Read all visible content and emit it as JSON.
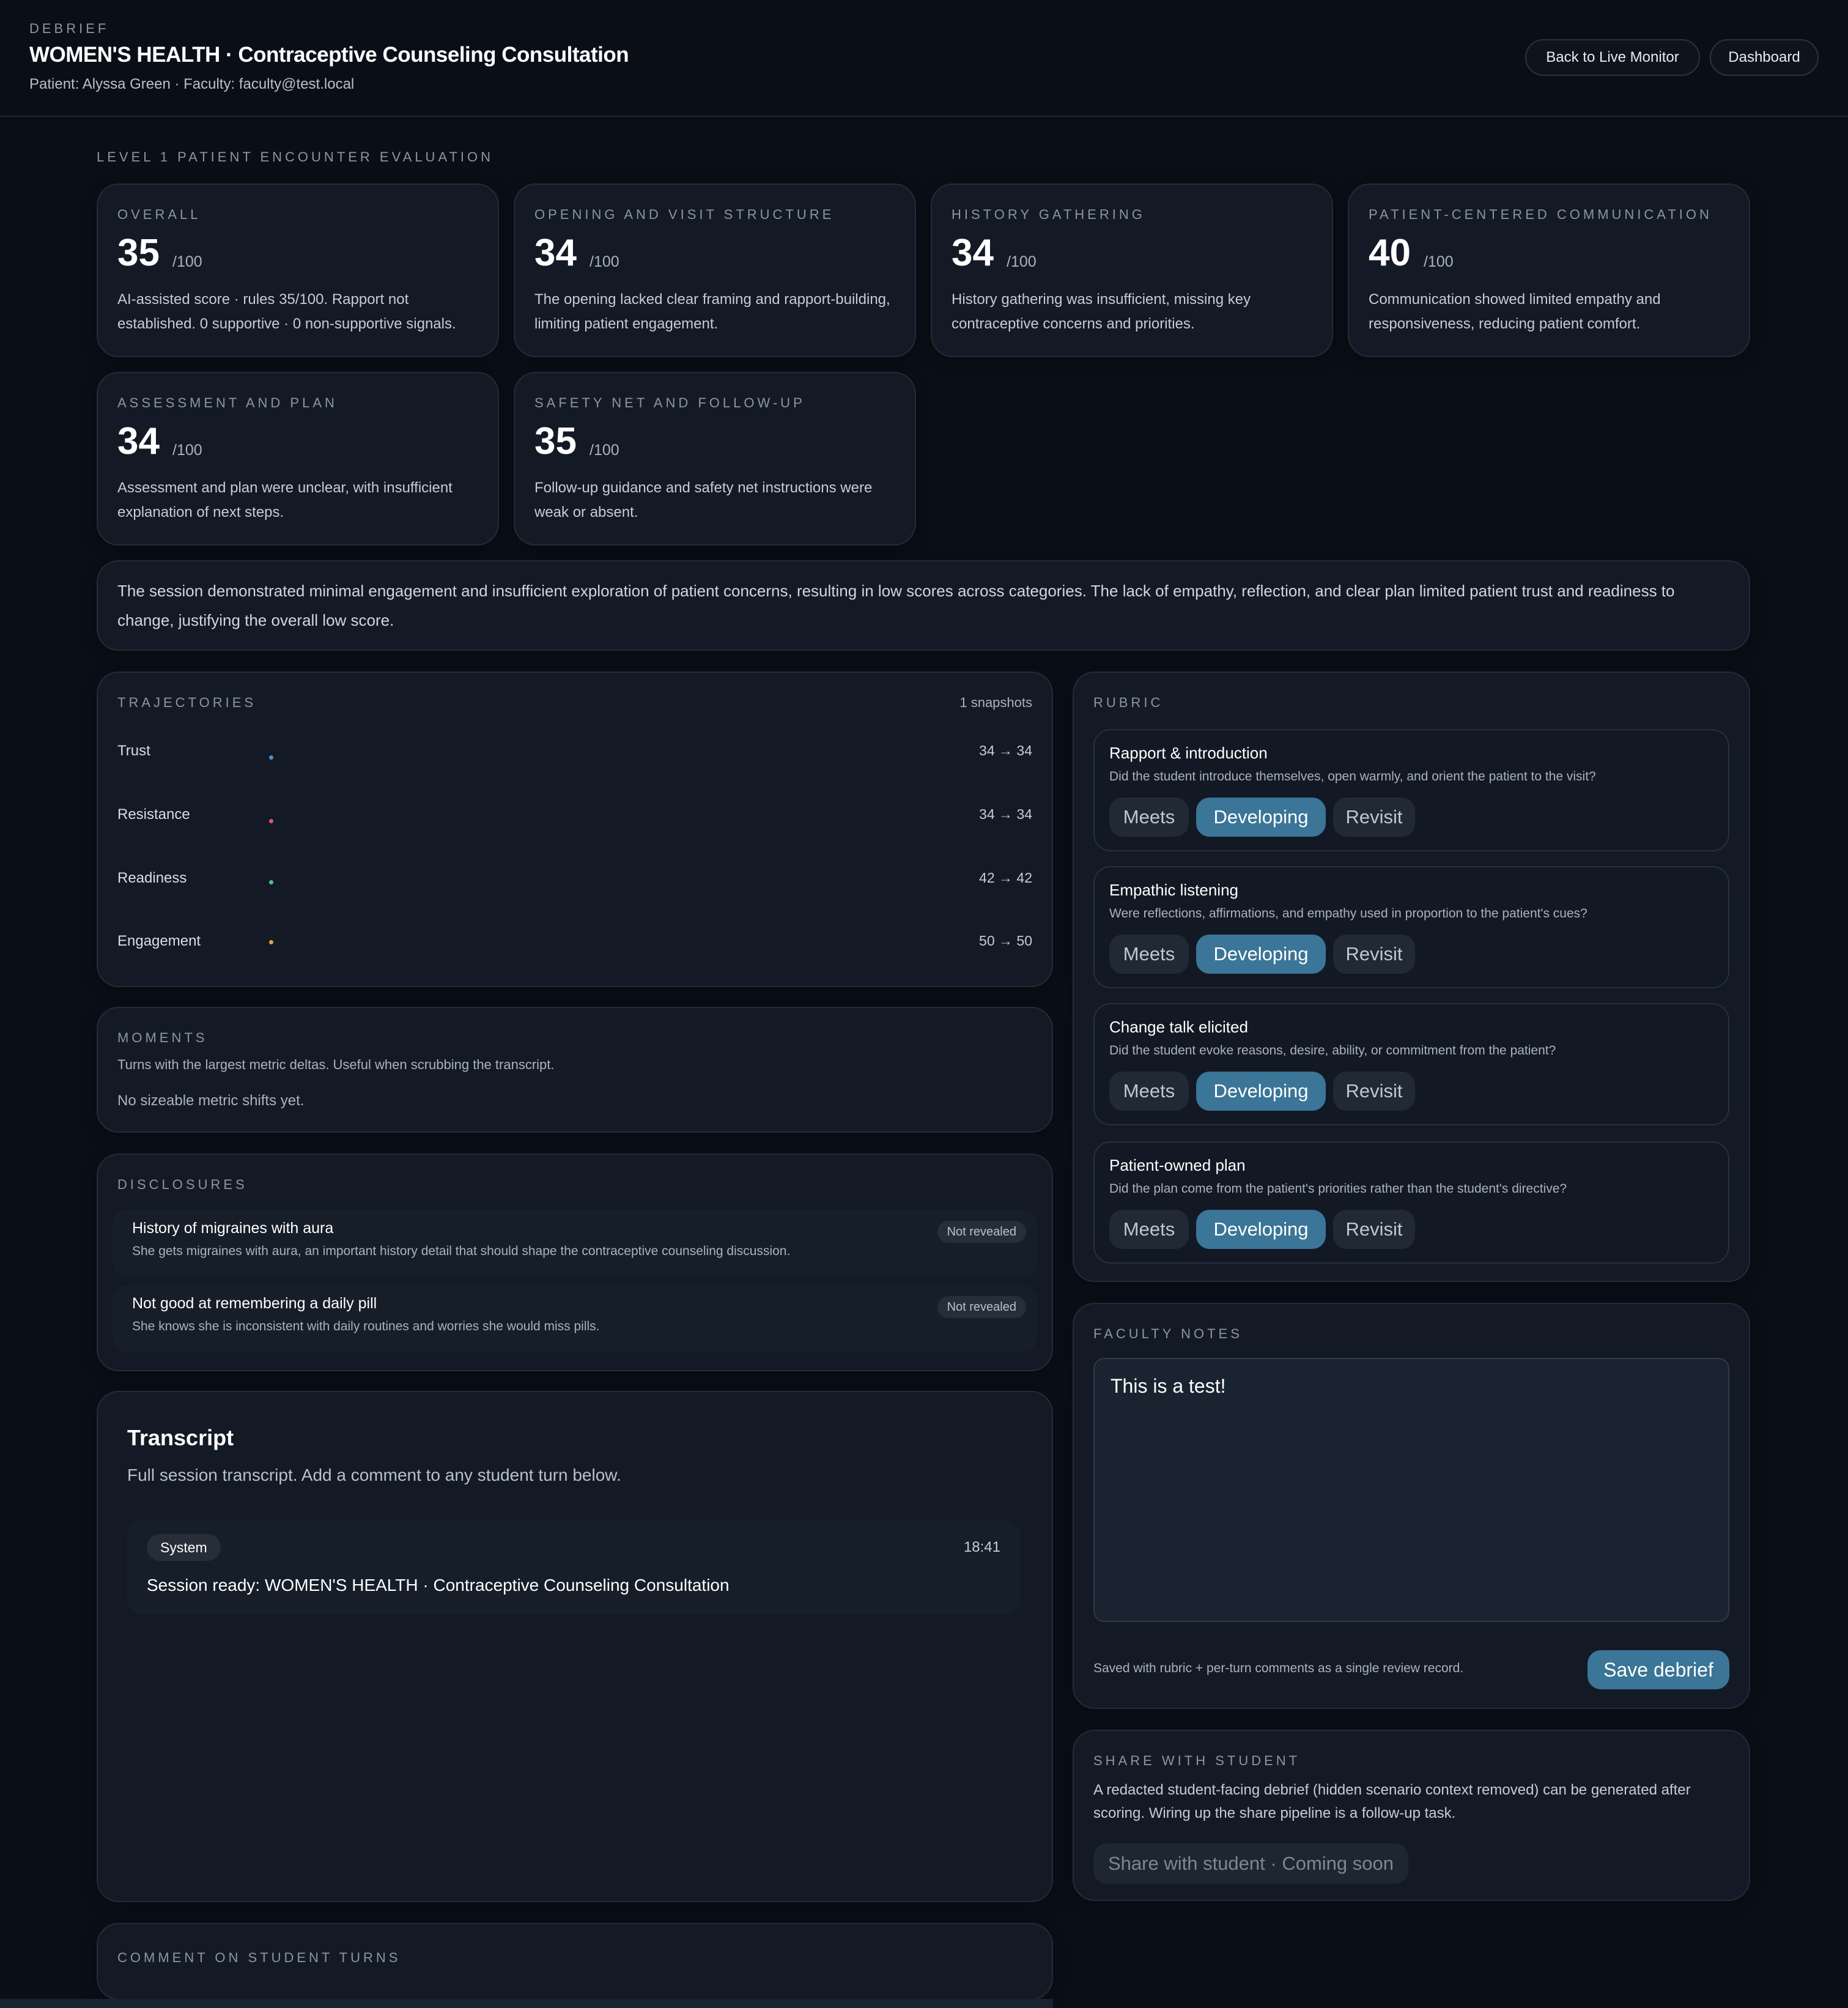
{
  "header": {
    "eyebrow": "DEBRIEF",
    "title": "WOMEN'S HEALTH · Contraceptive Counseling Consultation",
    "subtitle": "Patient: Alyssa Green · Faculty: faculty@test.local",
    "back_label": "Back to Live Monitor",
    "dashboard_label": "Dashboard"
  },
  "evaluation": {
    "heading": "LEVEL 1 PATIENT ENCOUNTER EVALUATION",
    "cards": [
      {
        "label": "OVERALL",
        "score": "35",
        "outof": "/100",
        "desc": "AI-assisted score · rules 35/100. Rapport not established. 0 supportive · 0 non-supportive signals."
      },
      {
        "label": "OPENING AND VISIT STRUCTURE",
        "score": "34",
        "outof": "/100",
        "desc": "The opening lacked clear framing and rapport-building, limiting patient engagement."
      },
      {
        "label": "HISTORY GATHERING",
        "score": "34",
        "outof": "/100",
        "desc": "History gathering was insufficient, missing key contraceptive concerns and priorities."
      },
      {
        "label": "PATIENT-CENTERED COMMUNICATION",
        "score": "40",
        "outof": "/100",
        "desc": "Communication showed limited empathy and responsiveness, reducing patient comfort."
      },
      {
        "label": "ASSESSMENT AND PLAN",
        "score": "34",
        "outof": "/100",
        "desc": "Assessment and plan were unclear, with insufficient explanation of next steps."
      },
      {
        "label": "SAFETY NET AND FOLLOW-UP",
        "score": "35",
        "outof": "/100",
        "desc": "Follow-up guidance and safety net instructions were weak or absent."
      }
    ],
    "summary": "The session demonstrated minimal engagement and insufficient exploration of patient concerns, resulting in low scores across categories. The lack of empathy, reflection, and clear plan limited patient trust and readiness to change, justifying the overall low score."
  },
  "trajectories": {
    "heading": "TRAJECTORIES",
    "count": "1 snapshots",
    "items": [
      {
        "name": "Trust",
        "range": "34 → 34",
        "color": "#4a8fd1"
      },
      {
        "name": "Resistance",
        "range": "34 → 34",
        "color": "#e0566a"
      },
      {
        "name": "Readiness",
        "range": "42 → 42",
        "color": "#4fc28a"
      },
      {
        "name": "Engagement",
        "range": "50 → 50",
        "color": "#e7a04a"
      }
    ]
  },
  "moments": {
    "heading": "MOMENTS",
    "desc": "Turns with the largest metric deltas. Useful when scrubbing the transcript.",
    "empty": "No sizeable metric shifts yet."
  },
  "disclosures": {
    "heading": "DISCLOSURES",
    "items": [
      {
        "title": "History of migraines with aura",
        "desc": "She gets migraines with aura, an important history detail that should shape the contraceptive counseling discussion.",
        "status": "Not revealed"
      },
      {
        "title": "Not good at remembering a daily pill",
        "desc": "She knows she is inconsistent with daily routines and worries she would miss pills.",
        "status": "Not revealed"
      }
    ]
  },
  "transcript": {
    "title": "Transcript",
    "subtitle": "Full session transcript. Add a comment to any student turn below.",
    "messages": [
      {
        "role": "System",
        "time": "18:41",
        "text": "Session ready: WOMEN'S HEALTH · Contraceptive Counseling Consultation"
      }
    ]
  },
  "comments": {
    "heading": "COMMENT ON STUDENT TURNS"
  },
  "rubric": {
    "heading": "RUBRIC",
    "options": [
      "Meets",
      "Developing",
      "Revisit"
    ],
    "items": [
      {
        "title": "Rapport & introduction",
        "desc": "Did the student introduce themselves, open warmly, and orient the patient to the visit?",
        "selected": "Developing"
      },
      {
        "title": "Empathic listening",
        "desc": "Were reflections, affirmations, and empathy used in proportion to the patient's cues?",
        "selected": "Developing"
      },
      {
        "title": "Change talk elicited",
        "desc": "Did the student evoke reasons, desire, ability, or commitment from the patient?",
        "selected": "Developing"
      },
      {
        "title": "Patient-owned plan",
        "desc": "Did the plan come from the patient's priorities rather than the student's directive?",
        "selected": "Developing"
      }
    ]
  },
  "faculty_notes": {
    "heading": "FACULTY NOTES",
    "value": "This is a test!",
    "saved_note": "Saved with rubric + per-turn comments as a single review record.",
    "save_label": "Save debrief"
  },
  "share": {
    "heading": "SHARE WITH STUDENT",
    "desc": "A redacted student-facing debrief (hidden scenario context removed) can be generated after scoring. Wiring up the share pipeline is a follow-up task.",
    "button_label": "Share with student · Coming soon"
  }
}
